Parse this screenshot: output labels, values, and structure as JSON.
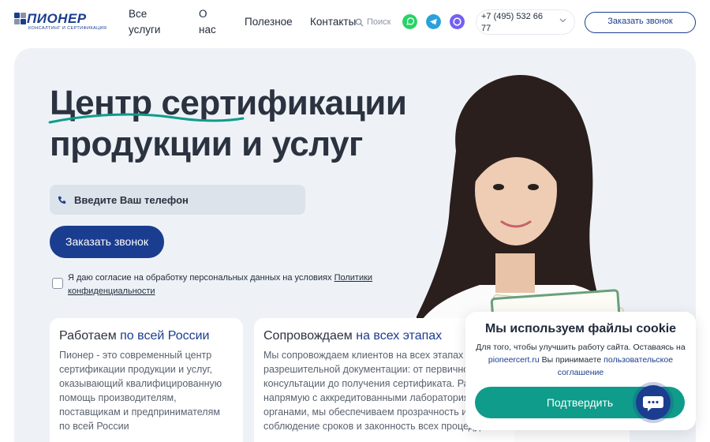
{
  "header": {
    "logo": {
      "name": "ПИОНЕР",
      "tagline": "КОНСАЛТИНГ И СЕРТИФИКАЦИЯ"
    },
    "nav": [
      {
        "line1": "Все",
        "line2": "услуги"
      },
      {
        "line1": "О",
        "line2": "нас"
      },
      {
        "line1": "Полезное",
        "line2": ""
      },
      {
        "line1": "Контакты",
        "line2": ""
      }
    ],
    "search_label": "Поиск",
    "phone": "+7 (495) 532 66 77",
    "callback_button": "Заказать звонок",
    "colors": {
      "whatsapp": "#25d366",
      "telegram": "#2aa1da",
      "viber": "#7360f2"
    }
  },
  "hero": {
    "title_line1": "Центр сертификации",
    "title_line2": "продукции и услуг",
    "phone_placeholder": "Введите Ваш телефон",
    "cta_label": "Заказать звонок",
    "consent_text": "Я даю согласие на обработку персональных данных на условиях",
    "consent_link": "Политики конфиденциальности"
  },
  "cards": [
    {
      "title_plain": "Работаем ",
      "title_accent": "по всей России",
      "body": "Пионер - это современный центр сертификации продукции и услуг, оказывающий квалифицированную помощь производителям, поставщикам и предпринимателям по всей России"
    },
    {
      "title_plain": "Сопровождаем ",
      "title_accent": "на всех этапах",
      "body": "Мы сопровождаем клиентов на всех этапах разрешительной документации: от первичной консультации до получения сертификата. Работая напрямую с аккредитованными лабораториями и органами, мы обеспечиваем прозрачность и соблюдение сроков и законность всех процедур"
    }
  ],
  "cookie": {
    "title": "Мы используем файлы cookie",
    "text_before": "Для того, чтобы улучшить работу сайта. Оставаясь на",
    "site_link": "pioneercert.ru",
    "text_after": "Вы принимаете",
    "agreement_link": "пользовательское соглашение",
    "confirm_label": "Подтвердить"
  },
  "colors": {
    "brand": "#1a3d8f",
    "accent_teal": "#0f9c8a",
    "hero_bg": "#eef2f7"
  }
}
